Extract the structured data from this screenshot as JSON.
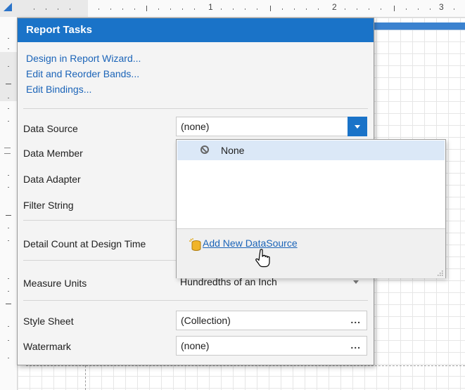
{
  "ruler": {
    "numbers": [
      "1",
      "2",
      "3"
    ]
  },
  "report_tasks": {
    "title": "Report Tasks",
    "links": [
      "Design in Report Wizard...",
      "Edit and Reorder Bands...",
      "Edit Bindings..."
    ],
    "properties": {
      "data_source": {
        "label": "Data Source",
        "value": "(none)"
      },
      "data_member": {
        "label": "Data Member"
      },
      "data_adapter": {
        "label": "Data Adapter"
      },
      "filter_string": {
        "label": "Filter String"
      },
      "detail_count": {
        "label": "Detail Count at Design Time"
      },
      "measure_units": {
        "label": "Measure Units",
        "value": "Hundredths of an Inch"
      },
      "style_sheet": {
        "label": "Style Sheet",
        "value": "(Collection)",
        "button": "..."
      },
      "watermark": {
        "label": "Watermark",
        "value": "(none)",
        "button": "..."
      }
    }
  },
  "datasource_dropdown": {
    "items": [
      {
        "label": "None",
        "icon": "no-entry-icon",
        "selected": true
      }
    ],
    "add_new_label": "Add New DataSource"
  },
  "colors": {
    "accent": "#1a73c8",
    "link": "#1b64b8",
    "selection": "#dbe8f7"
  }
}
